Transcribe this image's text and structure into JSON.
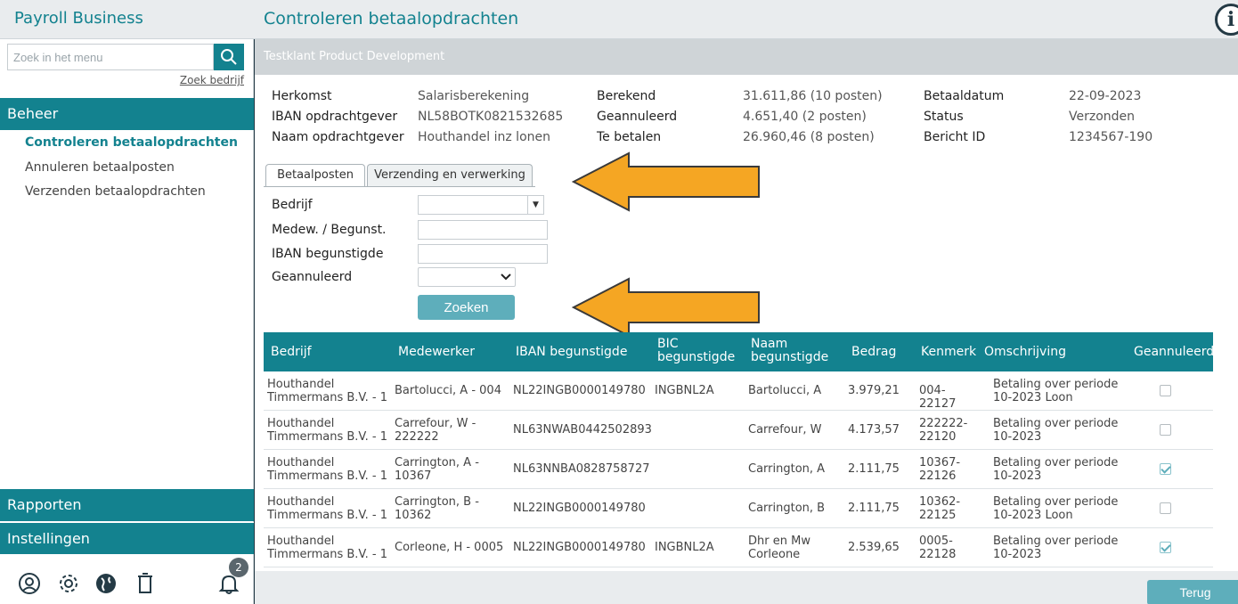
{
  "app": {
    "brand": "Payroll Business",
    "title": "Controleren betaalopdrachten",
    "info_icon": "i"
  },
  "sidebar": {
    "search_placeholder": "Zoek in het menu",
    "zoek_bedrijf": "Zoek bedrijf",
    "sections": {
      "beheer": "Beheer",
      "rapporten": "Rapporten",
      "instellingen": "Instellingen"
    },
    "items": [
      {
        "label": "Controleren betaalopdrachten",
        "active": true
      },
      {
        "label": "Annuleren betaalposten",
        "active": false
      },
      {
        "label": "Verzenden betaalopdrachten",
        "active": false
      }
    ],
    "icons": [
      "user-support-icon",
      "gear-icon",
      "globe-icon",
      "trash-icon",
      "bell-icon"
    ],
    "notification_count": "2"
  },
  "client_bar": "Testklant Product Development",
  "summary": {
    "col1": [
      {
        "label": "Herkomst",
        "value": "Salarisberekening"
      },
      {
        "label": "IBAN opdrachtgever",
        "value": "NL58BOTK0821532685"
      },
      {
        "label": "Naam opdrachtgever",
        "value": "Houthandel inz lonen"
      }
    ],
    "col2": [
      {
        "label": "Berekend",
        "value": "31.611,86 (10 posten)"
      },
      {
        "label": "Geannuleerd",
        "value": "4.651,40 (2 posten)"
      },
      {
        "label": "Te betalen",
        "value": "26.960,46 (8 posten)"
      }
    ],
    "col3": [
      {
        "label": "Betaaldatum",
        "value": "22-09-2023"
      },
      {
        "label": "Status",
        "value": "Verzonden"
      },
      {
        "label": "Bericht ID",
        "value": "1234567-190"
      }
    ]
  },
  "tabs": [
    "Betaalposten",
    "Verzending en verwerking"
  ],
  "filters": {
    "bedrijf": "Bedrijf",
    "medew": "Medew. / Begunst.",
    "iban": "IBAN begunstigde",
    "geannuleerd": "Geannuleerd",
    "search_button": "Zoeken"
  },
  "table": {
    "headers": [
      "Bedrijf",
      "Medewerker",
      "IBAN begunstigde",
      "BIC begunstigde",
      "Naam begunstigde",
      "Bedrag",
      "Kenmerk",
      "Omschrijving",
      "Geannuleerd"
    ],
    "rows": [
      {
        "bedrijf": "Houthandel Timmermans B.V. - 1",
        "medewerker": "Bartolucci, A - 004",
        "iban": "NL22INGB0000149780",
        "bic": "INGBNL2A",
        "naam": "Bartolucci, A",
        "bedrag": "3.979,21",
        "kenmerk": "004-22127",
        "omschrijving": "Betaling over periode 10-2023 Loon",
        "geannuleerd": false
      },
      {
        "bedrijf": "Houthandel Timmermans B.V. - 1",
        "medewerker": "Carrefour, W - 222222",
        "iban": "NL63NWAB0442502893",
        "bic": "",
        "naam": "Carrefour, W",
        "bedrag": "4.173,57",
        "kenmerk": "222222-22120",
        "omschrijving": "Betaling over periode 10-2023",
        "geannuleerd": false
      },
      {
        "bedrijf": "Houthandel Timmermans B.V. - 1",
        "medewerker": "Carrington, A - 10367",
        "iban": "NL63NNBA0828758727",
        "bic": "",
        "naam": "Carrington, A",
        "bedrag": "2.111,75",
        "kenmerk": "10367-22126",
        "omschrijving": "Betaling over periode 10-2023",
        "geannuleerd": true
      },
      {
        "bedrijf": "Houthandel Timmermans B.V. - 1",
        "medewerker": "Carrington, B - 10362",
        "iban": "NL22INGB0000149780",
        "bic": "",
        "naam": "Carrington, B",
        "bedrag": "2.111,75",
        "kenmerk": "10362-22125",
        "omschrijving": "Betaling over periode 10-2023 Loon",
        "geannuleerd": false
      },
      {
        "bedrijf": "Houthandel Timmermans B.V. - 1",
        "medewerker": "Corleone, H - 0005",
        "iban": "NL22INGB0000149780",
        "bic": "INGBNL2A",
        "naam": "Dhr en Mw Corleone",
        "bedrag": "2.539,65",
        "kenmerk": "0005-22128",
        "omschrijving": "Betaling over periode 10-2023",
        "geannuleerd": true
      }
    ]
  },
  "footer": {
    "back_button": "Terug"
  },
  "colors": {
    "teal": "#13828f",
    "light_teal": "#5eaebb",
    "arrow": "#f5a623",
    "sidebar_dark": "#243a45"
  }
}
